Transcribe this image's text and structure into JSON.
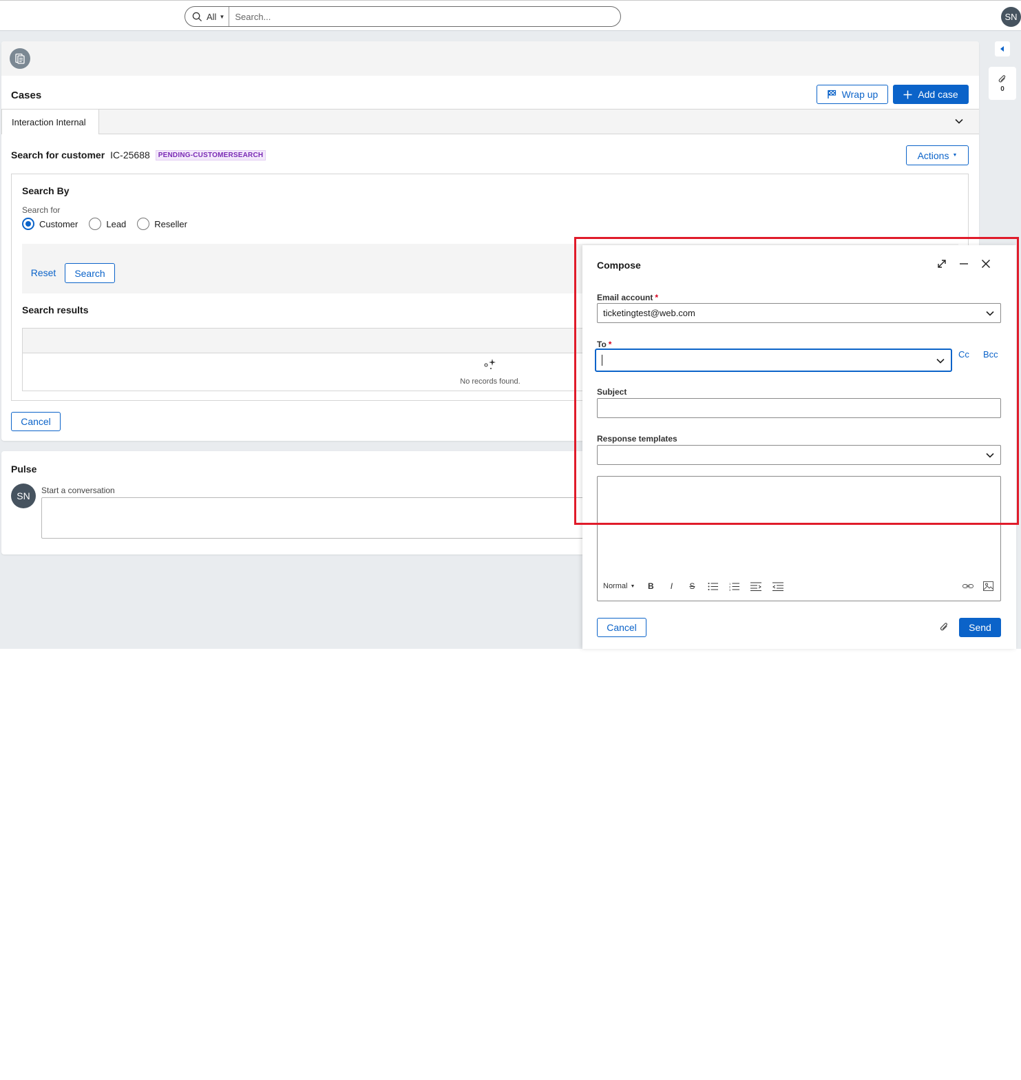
{
  "topbar": {
    "scope_label": "All",
    "search_placeholder": "Search...",
    "user_initials": "SN"
  },
  "cases": {
    "title": "Cases",
    "wrap_up_label": "Wrap up",
    "add_case_label": "Add case",
    "tab_label": "Interaction Internal",
    "search_for_customer_label": "Search for customer",
    "case_id": "IC-25688",
    "status_badge": "PENDING-CUSTOMERSEARCH",
    "actions_label": "Actions",
    "search_by_title": "Search By",
    "search_for_label": "Search for",
    "radio_options": [
      "Customer",
      "Lead",
      "Reseller"
    ],
    "selected_option": "Customer",
    "reset_label": "Reset",
    "search_label": "Search",
    "results_title": "Search results",
    "no_records": "No records found.",
    "cancel_label": "Cancel"
  },
  "pulse": {
    "title": "Pulse",
    "user_initials": "SN",
    "start_label": "Start a conversation"
  },
  "rail": {
    "attachment_count": "0"
  },
  "compose": {
    "title": "Compose",
    "email_account_label": "Email account",
    "email_account_value": "ticketingtest@web.com",
    "to_label": "To",
    "to_value": "",
    "cc_label": "Cc",
    "bcc_label": "Bcc",
    "subject_label": "Subject",
    "subject_value": "",
    "templates_label": "Response templates",
    "templates_value": "",
    "format_label": "Normal",
    "cancel_label": "Cancel",
    "send_label": "Send"
  },
  "colors": {
    "accent": "#0b63c9",
    "highlight_box": "#e01b2a",
    "badge_text": "#7a2bb5"
  }
}
